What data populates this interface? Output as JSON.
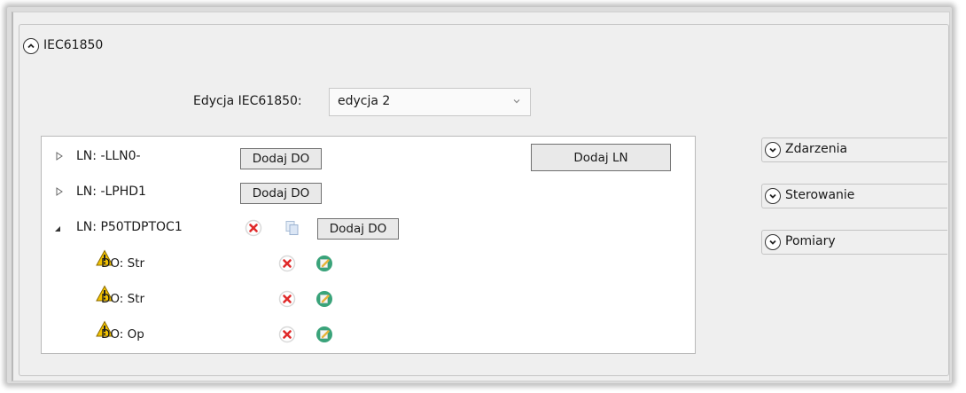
{
  "group": {
    "title": "IEC61850",
    "icon": "chevron-up-icon"
  },
  "edition": {
    "label": "Edycja IEC61850:",
    "selected": "edycja 2"
  },
  "tree": {
    "nodes": [
      {
        "label": "LN: -LLN0-",
        "expanded": false,
        "add_do": "Dodaj DO"
      },
      {
        "label": "LN: -LPHD1",
        "expanded": false,
        "add_do": "Dodaj DO"
      },
      {
        "label": "LN: P50TDPTOC1",
        "expanded": true,
        "add_do": "Dodaj DO",
        "children": [
          {
            "label": "DO: Str",
            "warning": true
          },
          {
            "label": "DO: Str",
            "warning": true
          },
          {
            "label": "DO: Op",
            "warning": true
          }
        ]
      }
    ],
    "add_ln": "Dodaj LN"
  },
  "side_panels": [
    {
      "title": "Zdarzenia",
      "icon": "chevron-down-icon"
    },
    {
      "title": "Sterowanie",
      "icon": "chevron-down-icon"
    },
    {
      "title": "Pomiary",
      "icon": "chevron-down-icon"
    }
  ],
  "colors": {
    "delete": "#e02a2a",
    "edit": "#3aa37a",
    "warning": "#f2c200"
  }
}
